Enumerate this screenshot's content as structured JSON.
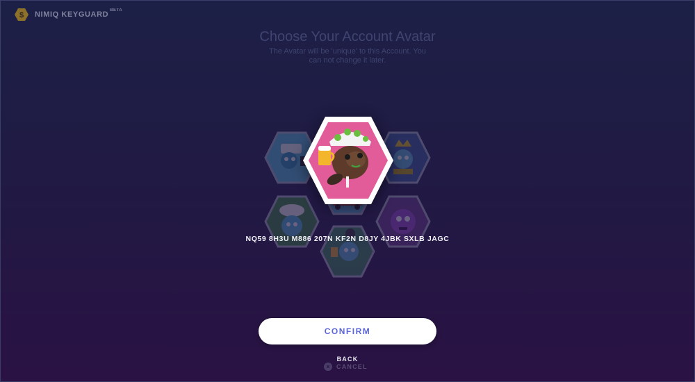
{
  "header": {
    "app_name": "NIMIQ KEYGUARD",
    "badge": "BETA",
    "logo_icon": "nimiq-hexagon-logo-icon"
  },
  "page": {
    "title": "Choose Your Account Avatar",
    "subtitle": "The Avatar will be 'unique' to this Account. You can not change it later."
  },
  "avatars": {
    "selected": {
      "icon": "beaver-with-beer-avatar-icon",
      "background": "#e35c9a"
    },
    "options": [
      {
        "icon": "robot-with-hat-avatar-icon"
      },
      {
        "icon": "crowned-creature-avatar-icon"
      },
      {
        "icon": "chef-hat-bird-avatar-icon"
      },
      {
        "icon": "car-avatar-icon"
      },
      {
        "icon": "purple-monster-avatar-icon"
      },
      {
        "icon": "bird-with-beer-avatar-icon"
      }
    ]
  },
  "address": "NQ59 8H3U M886 207N KF2N D8JY 4JBK SXLB JAGC",
  "actions": {
    "confirm_label": "CONFIRM",
    "back_label": "BACK",
    "cancel_label": "CANCEL"
  },
  "colors": {
    "accent": "#5b66d8",
    "background_top": "#1d2046",
    "background_bottom": "#2a1244"
  }
}
